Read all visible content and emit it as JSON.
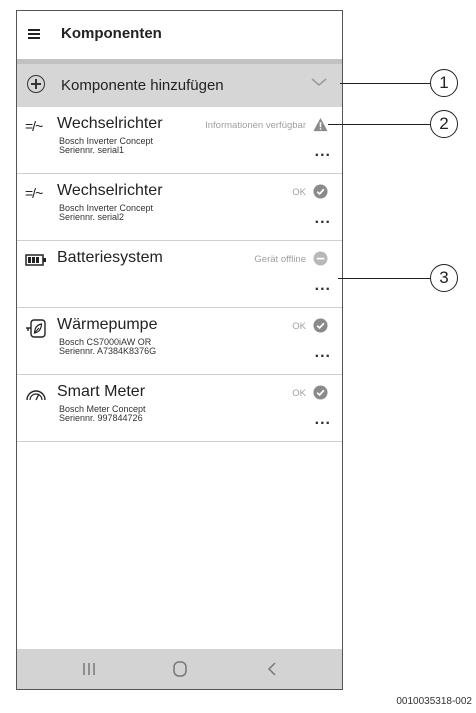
{
  "appbar": {
    "title": "Komponenten",
    "menu_icon": "hamburger-icon"
  },
  "add_component": {
    "label": "Komponente hinzufügen",
    "icon": "plus-circle-icon",
    "chevron": "chevron-down-icon"
  },
  "components": [
    {
      "name": "Wechselrichter",
      "icon": "inverter-icon",
      "line1": "Bosch Inverter Concept",
      "line2": "Seriennr. serial1",
      "status": "Informationen verfügbar",
      "status_icon": "warning-icon",
      "more": "..."
    },
    {
      "name": "Wechselrichter",
      "icon": "inverter-icon",
      "line1": "Bosch Inverter Concept",
      "line2": "Seriennr. serial2",
      "status": "OK",
      "status_icon": "check-icon",
      "more": "..."
    },
    {
      "name": "Batteriesystem",
      "icon": "battery-icon",
      "line1": "",
      "line2": "",
      "status": "Gerät offline",
      "status_icon": "offline-icon",
      "more": "..."
    },
    {
      "name": "Wärmepumpe",
      "icon": "heat-pump-icon",
      "line1": "Bosch CS7000iAW OR",
      "line2": "Seriennr. A7384K8376G",
      "status": "OK",
      "status_icon": "check-icon",
      "more": "..."
    },
    {
      "name": "Smart Meter",
      "icon": "smart-meter-icon",
      "line1": "Bosch Meter Concept",
      "line2": "Seriennr. 997844726",
      "status": "OK",
      "status_icon": "check-icon",
      "more": "..."
    }
  ],
  "navbar": {
    "recent_icon": "recent-apps-icon",
    "home_icon": "home-icon",
    "back_icon": "back-icon"
  },
  "callouts": [
    "1",
    "2",
    "3"
  ],
  "doc_id": "0010035318-002",
  "colors": {
    "add_row_bg": "#d6d6d6",
    "check": "#8a8a8a",
    "status_text": "#a0a0a0",
    "navbar": "#d3d3d3"
  }
}
